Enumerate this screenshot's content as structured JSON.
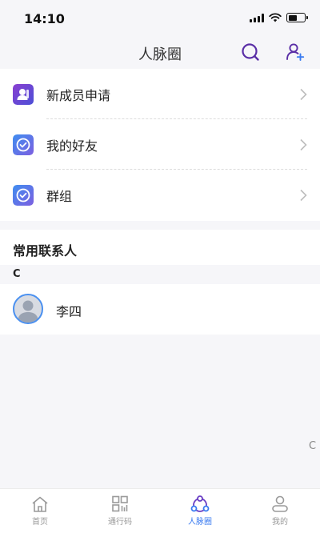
{
  "status_bar": {
    "time": "14:10"
  },
  "nav": {
    "title": "人脉圈",
    "search_icon": "search-icon",
    "add_user_icon": "add-user-icon"
  },
  "menu": {
    "items": [
      {
        "label": "新成员申请",
        "icon": "new-member-icon"
      },
      {
        "label": "我的好友",
        "icon": "check-badge-icon"
      },
      {
        "label": "群组",
        "icon": "check-badge-icon"
      }
    ]
  },
  "contacts": {
    "section_title": "常用联系人",
    "letter": "C",
    "items": [
      {
        "name": "李四"
      }
    ]
  },
  "index_bar": {
    "letter": "C"
  },
  "tab_bar": {
    "tabs": [
      {
        "label": "首页",
        "icon": "home-icon"
      },
      {
        "label": "通行码",
        "icon": "qr-grid-icon"
      },
      {
        "label": "人脉圈",
        "icon": "network-icon",
        "active": true
      },
      {
        "label": "我的",
        "icon": "profile-icon"
      }
    ]
  },
  "colors": {
    "accent": "#3a7bf0",
    "nav_icon": "#5a2ea6",
    "background": "#f6f6f9"
  }
}
